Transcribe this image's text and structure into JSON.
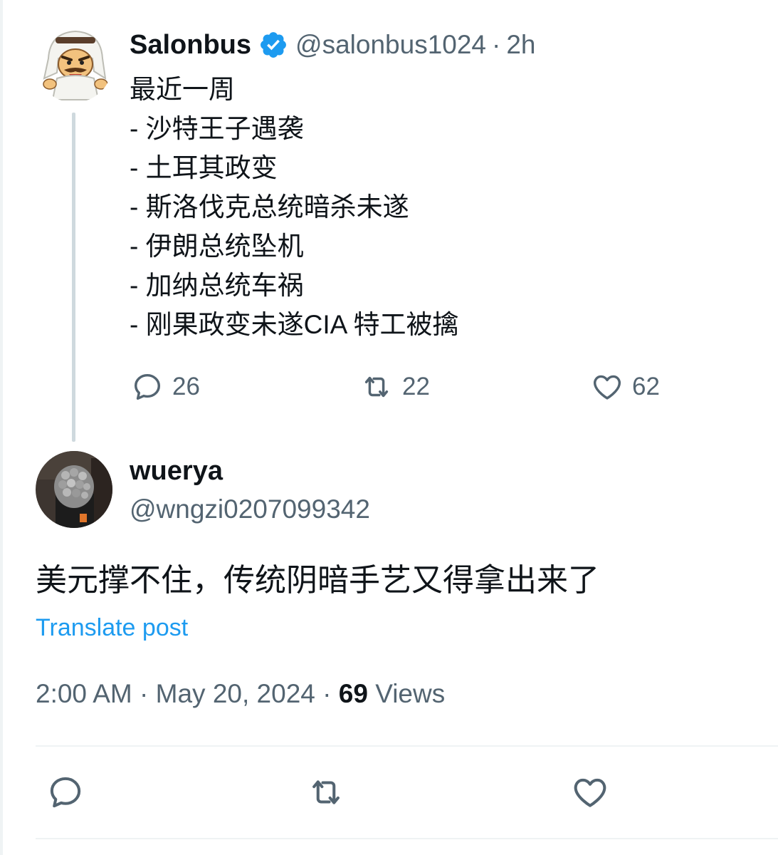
{
  "colors": {
    "text_primary": "#0f1419",
    "text_secondary": "#536471",
    "link": "#1d9bf0",
    "verified": "#1d9bf0",
    "divider": "#eff3f4",
    "thread_line": "#cfd9de"
  },
  "parent_tweet": {
    "display_name": "Salonbus",
    "verified_icon": "verified-badge-icon",
    "handle": "@salonbus1024",
    "separator": "·",
    "time_ago": "2h",
    "lines": [
      "最近一周",
      "- 沙特王子遇袭",
      "- 土耳其政变",
      "- 斯洛伐克总统暗杀未遂",
      "- 伊朗总统坠机",
      "- 加纳总统车祸",
      "- 刚果政变未遂CIA 特工被擒"
    ],
    "stats": {
      "replies": "26",
      "reposts": "22",
      "likes": "62"
    }
  },
  "reply_tweet": {
    "display_name": "wuerya",
    "handle": "@wngzi0207099342",
    "text": "美元撑不住，传统阴暗手艺又得拿出来了",
    "translate_label": "Translate post",
    "time": "2:00 AM",
    "separator": "·",
    "date": "May 20, 2024",
    "views_count": "69",
    "views_label": "Views"
  },
  "reply_actions": {
    "reply_icon": "reply-icon",
    "repost_icon": "repost-icon",
    "like_icon": "heart-icon"
  }
}
